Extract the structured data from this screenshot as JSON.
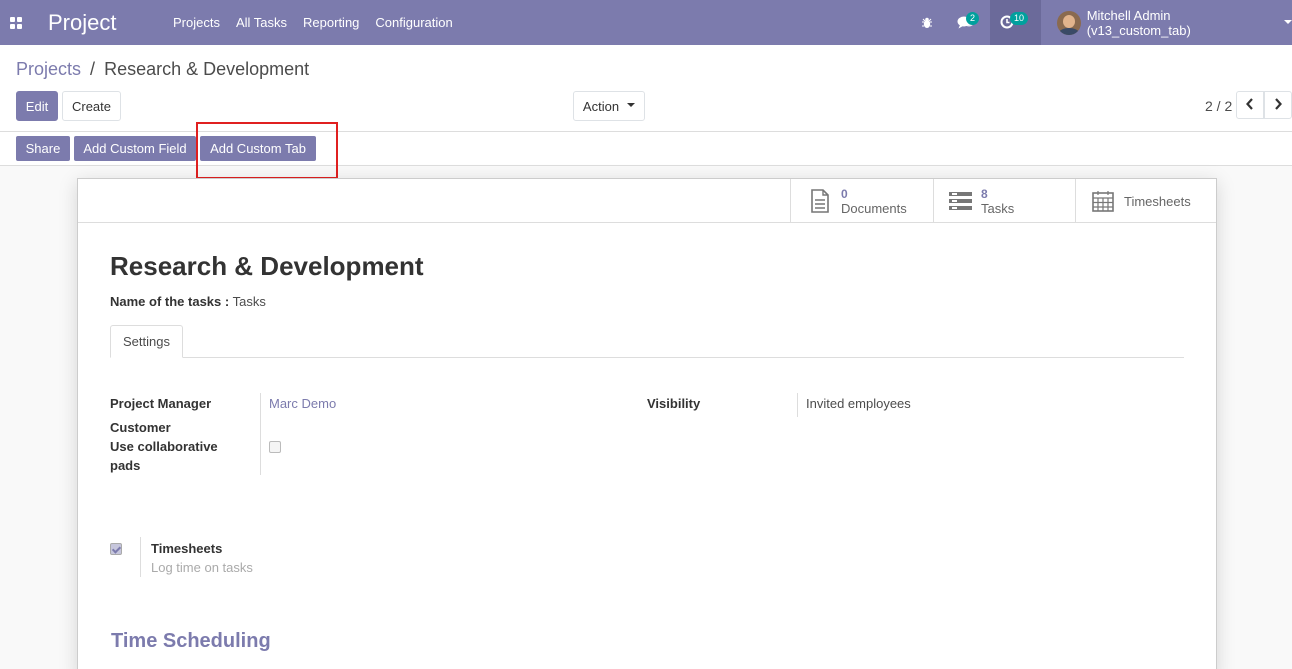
{
  "navbar": {
    "app_name": "Project",
    "menu": [
      "Projects",
      "All Tasks",
      "Reporting",
      "Configuration"
    ],
    "messages_count": "2",
    "activities_count": "10",
    "user_name": "Mitchell Admin (v13_custom_tab)"
  },
  "breadcrumb": {
    "parent": "Projects",
    "separator": "/",
    "current": "Research & Development"
  },
  "control": {
    "edit_label": "Edit",
    "create_label": "Create",
    "action_label": "Action",
    "pager": "2 / 2"
  },
  "statusbar": {
    "share_label": "Share",
    "add_field_label": "Add Custom Field",
    "add_tab_label": "Add Custom Tab"
  },
  "stats": {
    "documents_count": "0",
    "documents_label": "Documents",
    "tasks_count": "8",
    "tasks_label": "Tasks",
    "timesheets_label": "Timesheets"
  },
  "form": {
    "title": "Research & Development",
    "name_of_tasks_label": "Name of the tasks :",
    "name_of_tasks_value": "Tasks",
    "tab_settings": "Settings",
    "project_manager_label": "Project Manager",
    "project_manager_value": "Marc Demo",
    "customer_label": "Customer",
    "collab_label_1": "Use collaborative",
    "collab_label_2": "pads",
    "visibility_label": "Visibility",
    "visibility_value": "Invited employees",
    "timesheets_label": "Timesheets",
    "timesheets_help": "Log time on tasks",
    "time_scheduling_title": "Time Scheduling"
  },
  "colors": {
    "brand": "#7c7bad",
    "badge": "#00a09d",
    "highlight": "#e02020"
  }
}
